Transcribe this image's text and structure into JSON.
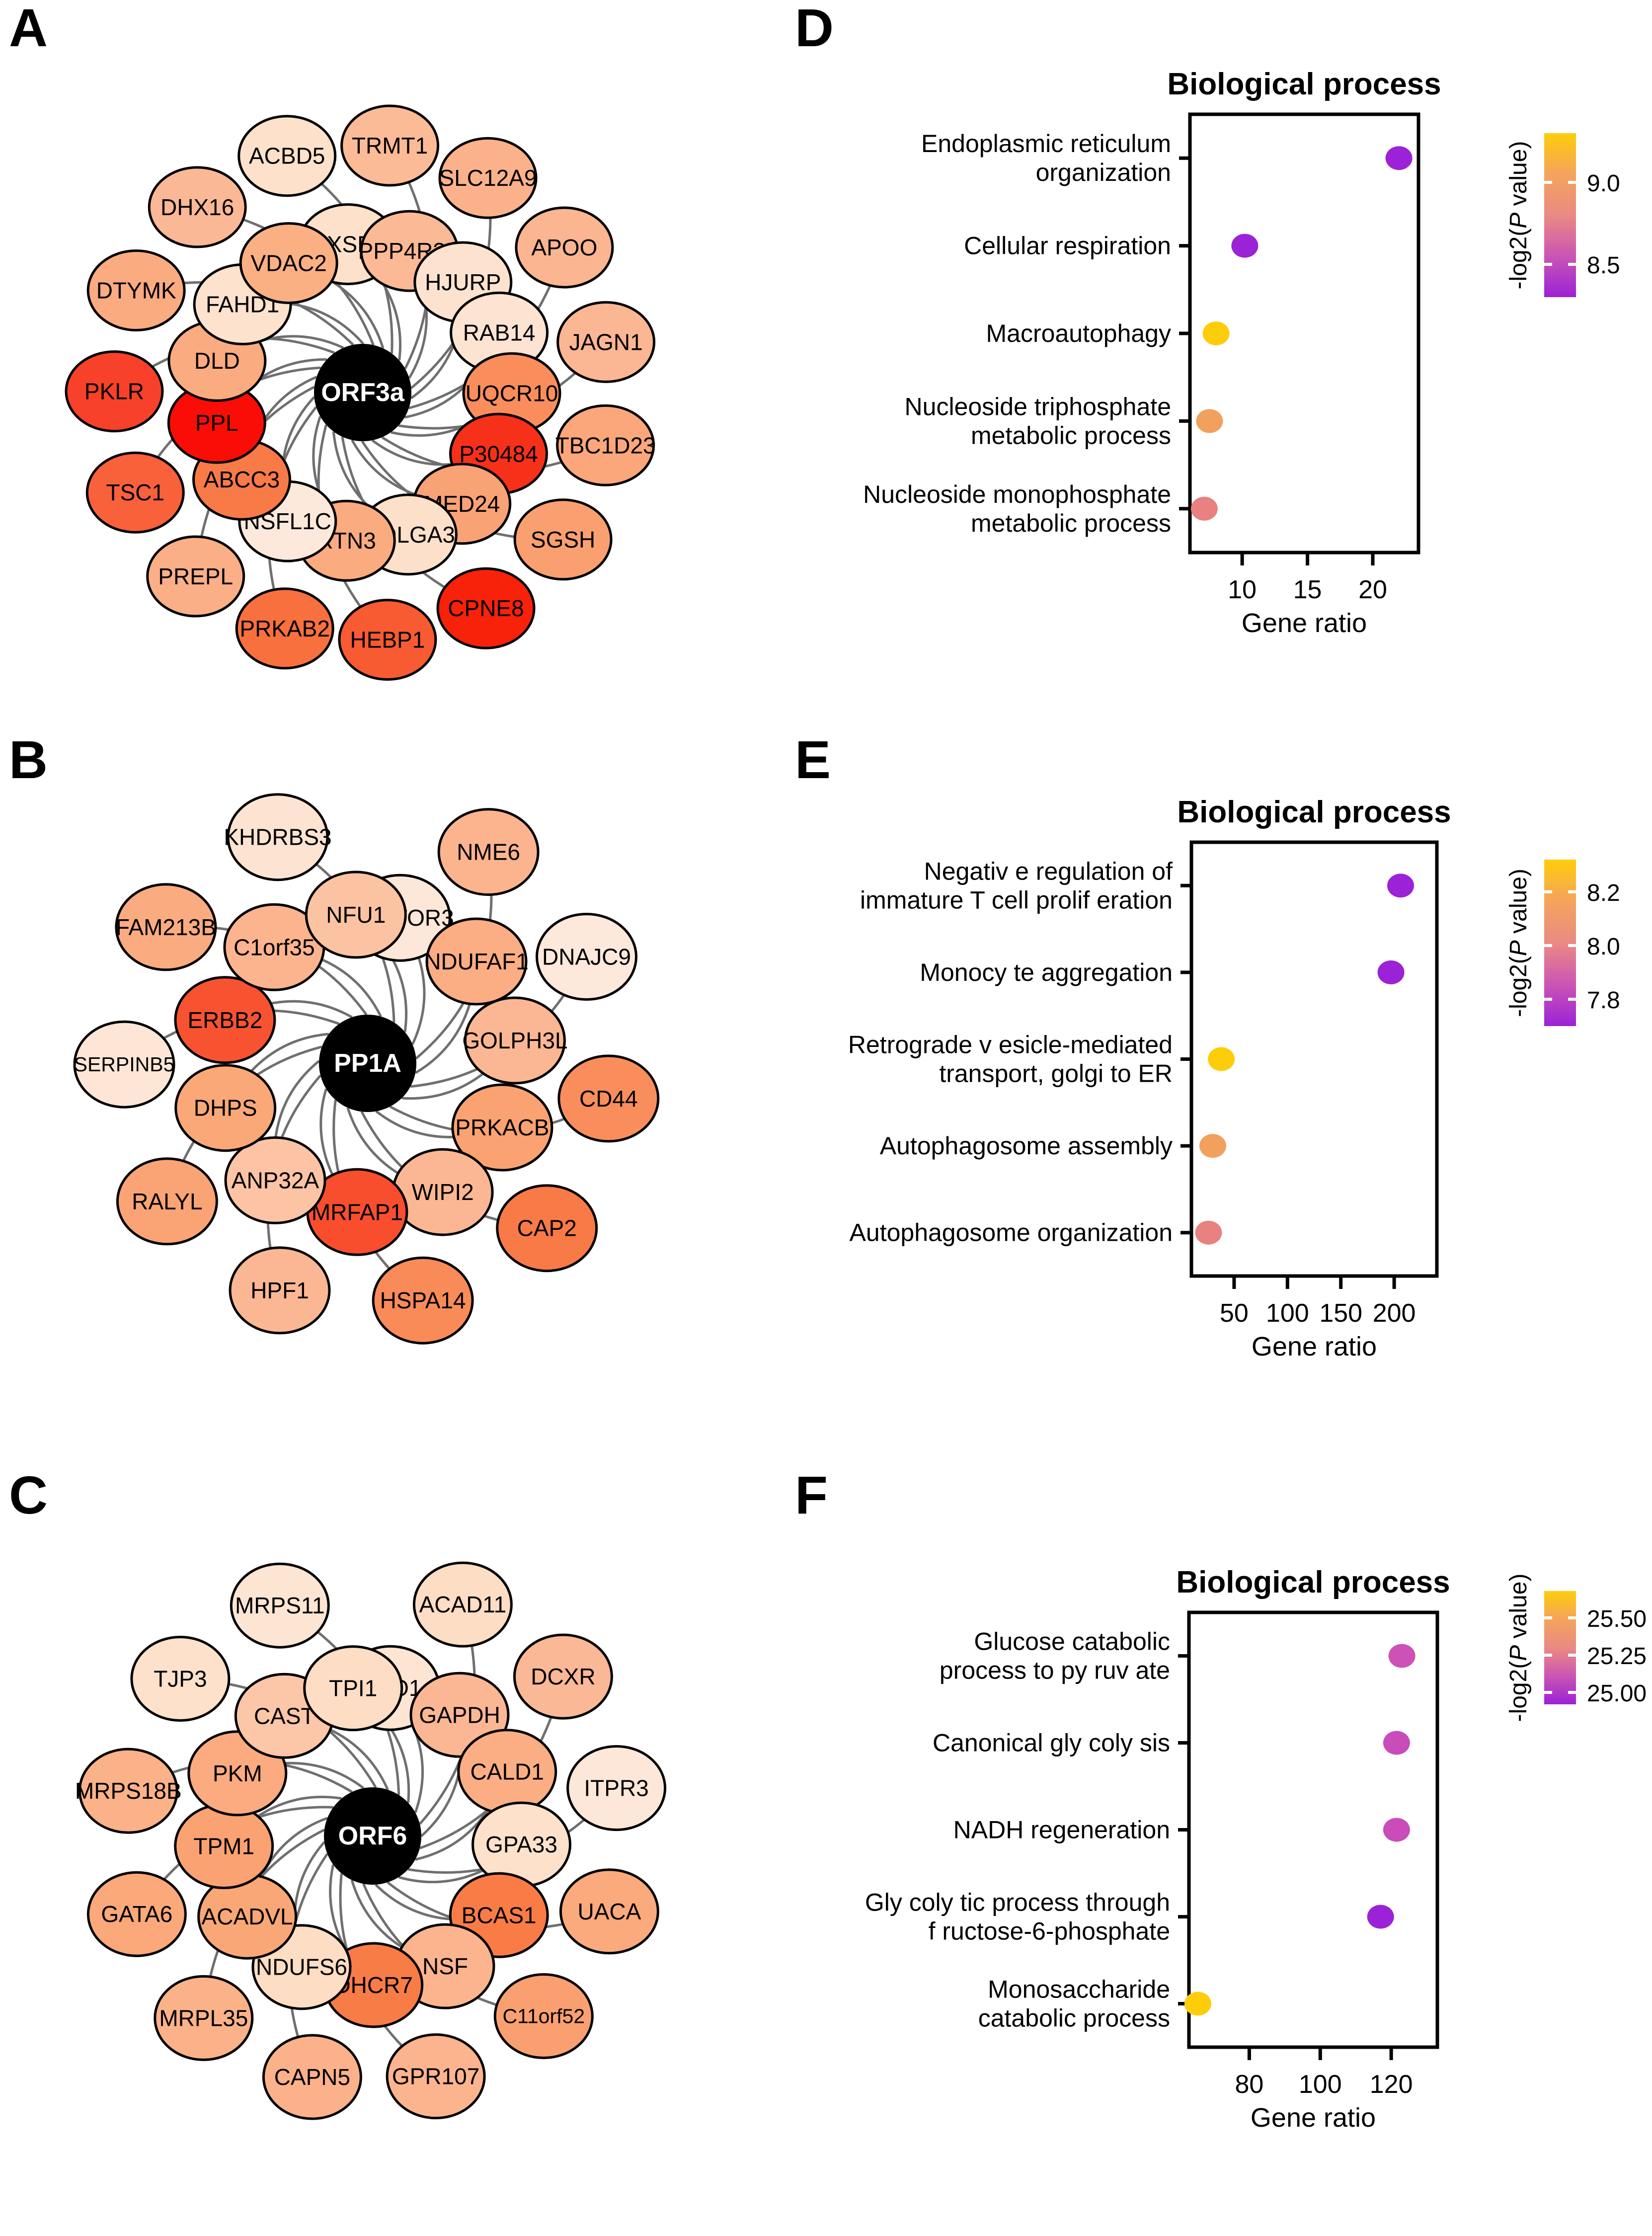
{
  "figure": {
    "panels": [
      "A",
      "B",
      "C",
      "D",
      "E",
      "F"
    ]
  },
  "networks": [
    {
      "letter": "A",
      "hub": "ORF3a",
      "nodes": [
        {
          "label": "OXSR1",
          "color": "#fde1cb"
        },
        {
          "label": "TRMT1",
          "color": "#fbbb96"
        },
        {
          "label": "PPP4R3B",
          "color": "#fbb995"
        },
        {
          "label": "SLC12A9",
          "color": "#fbb28b"
        },
        {
          "label": "HJURP",
          "color": "#fde3cf"
        },
        {
          "label": "APOO",
          "color": "#fbb591"
        },
        {
          "label": "RAB14",
          "color": "#fde4d2"
        },
        {
          "label": "JAGN1",
          "color": "#fbb694"
        },
        {
          "label": "UQCR10",
          "color": "#f98e5c"
        },
        {
          "label": "TBC1D23",
          "color": "#fba77b"
        },
        {
          "label": "P30484",
          "color": "#f7301a"
        },
        {
          "label": "SGSH",
          "color": "#faa070"
        },
        {
          "label": "MED24",
          "color": "#f9a276"
        },
        {
          "label": "CPNE8",
          "color": "#f8210a"
        },
        {
          "label": "GOLGA3",
          "color": "#fde0c9"
        },
        {
          "label": "HEBP1",
          "color": "#f85a31"
        },
        {
          "label": "RTN3",
          "color": "#fbab80"
        },
        {
          "label": "PRKAB2",
          "color": "#f8703d"
        },
        {
          "label": "NSFL1C",
          "color": "#fde9db"
        },
        {
          "label": "PREPL",
          "color": "#fbaf87"
        },
        {
          "label": "ABCC3",
          "color": "#f87a47"
        },
        {
          "label": "TSC1",
          "color": "#f8613a"
        },
        {
          "label": "PPL",
          "color": "#fa0d06"
        },
        {
          "label": "PKLR",
          "color": "#f8412a"
        },
        {
          "label": "DLD",
          "color": "#fbab80"
        },
        {
          "label": "DTYMK",
          "color": "#fbab80"
        },
        {
          "label": "FAHD1",
          "color": "#fde2cd"
        },
        {
          "label": "DHX16",
          "color": "#fbb896"
        },
        {
          "label": "VDAC2",
          "color": "#fbb083"
        },
        {
          "label": "ACBD5",
          "color": "#fde1ca"
        }
      ]
    },
    {
      "letter": "B",
      "hub": "PP1A",
      "nodes": [
        {
          "label": "LAMTOR3",
          "color": "#fde7d8"
        },
        {
          "label": "NME6",
          "color": "#fbb48e"
        },
        {
          "label": "NDUFAF1",
          "color": "#fbad83"
        },
        {
          "label": "DNAJC9",
          "color": "#fde9db"
        },
        {
          "label": "GOLPH3L",
          "color": "#fbb793"
        },
        {
          "label": "CD44",
          "color": "#f98e5c"
        },
        {
          "label": "PRKACB",
          "color": "#faa271"
        },
        {
          "label": "CAP2",
          "color": "#f87a47"
        },
        {
          "label": "WIPI2",
          "color": "#fbb793"
        },
        {
          "label": "HSPA14",
          "color": "#f98b58"
        },
        {
          "label": "MRFAP1",
          "color": "#f84e2e"
        },
        {
          "label": "HPF1",
          "color": "#fbb793"
        },
        {
          "label": "ANP32A",
          "color": "#fcc4a5"
        },
        {
          "label": "RALYL",
          "color": "#faa475"
        },
        {
          "label": "DHPS",
          "color": "#faa878"
        },
        {
          "label": "SERPINB5",
          "color": "#fde6d6"
        },
        {
          "label": "ERBB2",
          "color": "#f85331"
        },
        {
          "label": "FAM213B",
          "color": "#fbab80"
        },
        {
          "label": "C1orf35",
          "color": "#fbb48e"
        },
        {
          "label": "KHDRBS3",
          "color": "#fde4d2"
        },
        {
          "label": "NFU1",
          "color": "#fcc3a2"
        }
      ]
    },
    {
      "letter": "C",
      "hub": "ORF6",
      "nodes": [
        {
          "label": "ENO1",
          "color": "#fde4d3"
        },
        {
          "label": "ACAD11",
          "color": "#fdddc3"
        },
        {
          "label": "GAPDH",
          "color": "#fbb794"
        },
        {
          "label": "DCXR",
          "color": "#fbb896"
        },
        {
          "label": "CALD1",
          "color": "#fbae84"
        },
        {
          "label": "ITPR3",
          "color": "#fde7d8"
        },
        {
          "label": "GPA33",
          "color": "#fde1cb"
        },
        {
          "label": "UACA",
          "color": "#fbaa7d"
        },
        {
          "label": "BCAS1",
          "color": "#f97c46"
        },
        {
          "label": "C11orf52",
          "color": "#faa070"
        },
        {
          "label": "NSF",
          "color": "#fbb48e"
        },
        {
          "label": "GPR107",
          "color": "#fbb48e"
        },
        {
          "label": "DHCR7",
          "color": "#f87c46"
        },
        {
          "label": "CAPN5",
          "color": "#fbb18a"
        },
        {
          "label": "NDUFS6",
          "color": "#fdddc3"
        },
        {
          "label": "MRPL35",
          "color": "#fbb289"
        },
        {
          "label": "ACADVL",
          "color": "#faa777"
        },
        {
          "label": "GATA6",
          "color": "#fba87b"
        },
        {
          "label": "TPM1",
          "color": "#faa271"
        },
        {
          "label": "MRPS18B",
          "color": "#fbb289"
        },
        {
          "label": "PKM",
          "color": "#fbab7f"
        },
        {
          "label": "TJP3",
          "color": "#fde1cb"
        },
        {
          "label": "CAST",
          "color": "#fcc6a8"
        },
        {
          "label": "MRPS11",
          "color": "#fde5d4"
        },
        {
          "label": "TPI1",
          "color": "#fdddc4"
        }
      ]
    }
  ],
  "chart_data": [
    {
      "panel": "D",
      "type": "scatter",
      "title": "Biological process",
      "xlabel": "Gene ratio",
      "ylabel": "",
      "xticks": [
        10,
        15,
        20
      ],
      "xlim": [
        6.0,
        23.5
      ],
      "categories": [
        "Endoplasmic reticulum organization",
        "Cellular respiration",
        "Macroautophagy",
        "Nucleoside triphosphate metabolic process",
        "Nucleoside monophosphate metabolic process"
      ],
      "category_lines": [
        [
          "Endoplasmic reticulum",
          "organization"
        ],
        [
          "Cellular respiration"
        ],
        [
          "Macroautophagy"
        ],
        [
          "Nucleoside triphosphate",
          "metabolic process"
        ],
        [
          "Nucleoside monophosphate",
          "metabolic process"
        ]
      ],
      "x": [
        22.0,
        10.2,
        8.0,
        7.5,
        7.1
      ],
      "colors": [
        "#9b22d6",
        "#9b22d6",
        "#fecd0a",
        "#f2a05e",
        "#e8817f"
      ],
      "point_values": [
        8.35,
        8.35,
        9.25,
        8.95,
        8.78
      ],
      "colorbar": {
        "label": "-log2(P value)",
        "ticks": [
          "9.0",
          "8.5"
        ],
        "tick_values": [
          9.0,
          8.5
        ],
        "vmin": 8.3,
        "vmax": 9.3,
        "gradient": [
          "#fecd0a",
          "#f5a35c",
          "#ea8a82",
          "#cb55b4",
          "#9b22d6"
        ]
      }
    },
    {
      "panel": "E",
      "type": "scatter",
      "title": "Biological process",
      "xlabel": "Gene ratio",
      "ylabel": "",
      "xticks": [
        50,
        100,
        150,
        200
      ],
      "xlim": [
        10,
        240
      ],
      "categories": [
        "Negative regulation of immature T cell proliferation",
        "Monocyte aggregation",
        "Retrograde vesicle-mediated transport, golgi to ER",
        "Autophagosome assembly",
        "Autophagosome organization"
      ],
      "category_lines": [
        [
          "Negativ e regulation of",
          "immature T cell prolif eration"
        ],
        [
          "Monocy te aggregation"
        ],
        [
          "Retrograde v esicle-mediated",
          "transport, golgi to ER"
        ],
        [
          "Autophagosome assembly"
        ],
        [
          "Autophagosome organization"
        ]
      ],
      "x": [
        206,
        197,
        38,
        30,
        26
      ],
      "colors": [
        "#9b22d6",
        "#9b22d6",
        "#fecd0a",
        "#f2a05e",
        "#e8817f"
      ],
      "point_values": [
        7.75,
        7.75,
        8.3,
        8.1,
        7.98
      ],
      "colorbar": {
        "label": "-log2(P value)",
        "ticks": [
          "8.2",
          "8.0",
          "7.8"
        ],
        "tick_values": [
          8.2,
          8.0,
          7.8
        ],
        "vmin": 7.7,
        "vmax": 8.32,
        "gradient": [
          "#fecd0a",
          "#f5a35c",
          "#ea8a82",
          "#cb55b4",
          "#9b22d6"
        ]
      }
    },
    {
      "panel": "F",
      "type": "scatter",
      "title": "Biological process",
      "xlabel": "Gene ratio",
      "ylabel": "",
      "xticks": [
        80,
        100,
        120
      ],
      "xlim": [
        63,
        133
      ],
      "categories": [
        "Glucose catabolic process to pyruvate",
        "Canonical glycolysis",
        "NADH regeneration",
        "Glycolytic process through fructose-6-phosphate",
        "Monosaccharide catabolic process"
      ],
      "category_lines": [
        [
          "Glucose catabolic",
          "process to py ruv ate"
        ],
        [
          "Canonical gly coly sis"
        ],
        [
          "NADH regeneration"
        ],
        [
          "Gly coly tic process through",
          "f ructose-6-phosphate"
        ],
        [
          "Monosaccharide",
          "catabolic process"
        ]
      ],
      "x": [
        123.0,
        121.5,
        121.5,
        117.0,
        65.5
      ],
      "colors": [
        "#cd51b6",
        "#c94cba",
        "#c94cba",
        "#9b22d6",
        "#fecd0a"
      ],
      "point_values": [
        25.18,
        25.14,
        25.14,
        25.0,
        25.62
      ],
      "colorbar": {
        "label": "-log2(P value)",
        "ticks": [
          "25.50",
          "25.25",
          "25.00"
        ],
        "tick_values": [
          25.5,
          25.25,
          25.0
        ],
        "vmin": 24.92,
        "vmax": 25.68,
        "gradient": [
          "#fecd0a",
          "#f5a35c",
          "#ea8a82",
          "#cb55b4",
          "#9b22d6"
        ]
      }
    }
  ]
}
